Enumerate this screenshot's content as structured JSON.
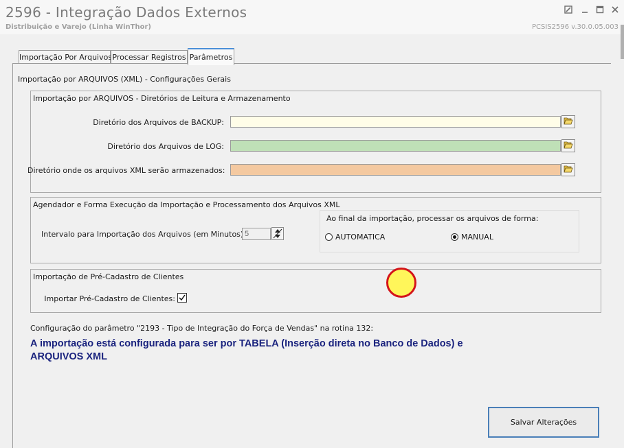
{
  "window": {
    "title": "2596 - Integração Dados Externos",
    "subtitle": "Distribuição e Varejo (Linha WinThor)",
    "version": "PCSIS2596  v.30.0.05.003",
    "controls": [
      "edit-icon",
      "minimize-icon",
      "maximize-icon",
      "close-icon"
    ]
  },
  "tabs": [
    {
      "label": "Importação Por Arquivos",
      "active": false
    },
    {
      "label": "Processar Registros",
      "active": false
    },
    {
      "label": "Parâmetros",
      "active": true
    }
  ],
  "section_title": "Importação por ARQUIVOS (XML) - Configurações Gerais",
  "directories": {
    "title": "Importação por ARQUIVOS - Diretórios de Leitura e Armazenamento",
    "fields": [
      {
        "label": "Diretório dos Arquivos de BACKUP:",
        "value": "",
        "color": "#fffde8"
      },
      {
        "label": "Diretório dos Arquivos de LOG:",
        "value": "",
        "color": "#bfe0b7"
      },
      {
        "label": "Diretório onde os arquivos XML serão armazenados:",
        "value": "",
        "color": "#f4c9a0"
      }
    ],
    "folder_icon": "folder-open-icon"
  },
  "scheduler": {
    "title": "Agendador e Forma Execução da Importação e Processamento dos Arquivos XML",
    "interval_label": "Intervalo para Importação dos Arquivos (em Minutos):",
    "interval_value": "5",
    "process_title": "Ao final da importação, processar os arquivos de forma:",
    "options": [
      {
        "label": "AUTOMATICA",
        "selected": false
      },
      {
        "label": "MANUAL",
        "selected": true
      }
    ]
  },
  "preregistration": {
    "title": "Importação de Pré-Cadastro de Clientes",
    "checkbox_label": "Importar Pré-Cadastro de Clientes:",
    "checked": true
  },
  "parameter_note": "Configuração do parâmetro \"2193 - Tipo de Integração do Força de Vendas\" na rotina 132:",
  "notice": "A importação está configurada para ser por TABELA (Inserção direta no Banco de Dados) e ARQUIVOS XML",
  "save_button": "Salvar Alterações"
}
